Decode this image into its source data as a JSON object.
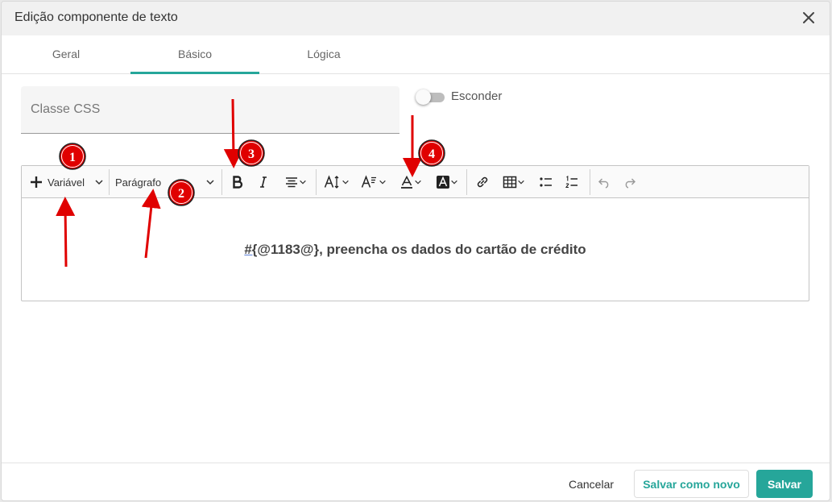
{
  "dialog": {
    "title": "Edição componente de texto"
  },
  "tabs": [
    {
      "label": "Geral"
    },
    {
      "label": "Básico"
    },
    {
      "label": "Lógica"
    }
  ],
  "form": {
    "css_class_placeholder": "Classe CSS",
    "hide_toggle_label": "Esconder"
  },
  "toolbar": {
    "variable_label": "Variável",
    "paragraph_label": "Parágrafo"
  },
  "editor": {
    "content_hash": "#{",
    "content_rest": "@1183@}, preencha os dados do cartão de crédito"
  },
  "annotations": [
    "1",
    "2",
    "3",
    "4"
  ],
  "footer": {
    "cancel_label": "Cancelar",
    "save_new_label": "Salvar como novo",
    "save_label": "Salvar"
  },
  "colors": {
    "accent": "#26a69a",
    "annotation": "#e00000"
  }
}
